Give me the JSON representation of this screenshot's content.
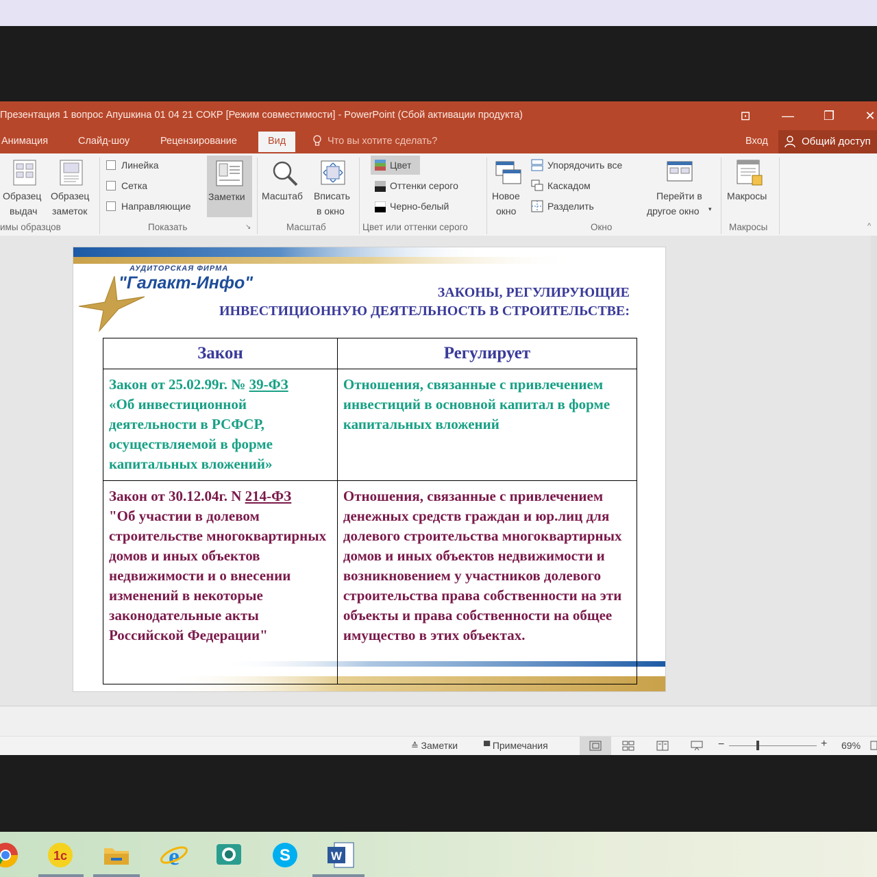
{
  "window": {
    "title": "Презентация 1 вопрос Апушкина  01 04 21 СОКР [Режим совместимости] - PowerPoint (Сбой активации продукта)",
    "buttons": [
      "⊡",
      "—",
      "❐",
      "✕"
    ]
  },
  "tabs": {
    "items": [
      "Анимация",
      "Слайд-шоу",
      "Рецензирование",
      "Вид"
    ],
    "active": "Вид",
    "tell_me": "Что вы хотите сделать?",
    "signin": "Вход",
    "share": "Общий доступ"
  },
  "ribbon": {
    "master_views": {
      "handout_1": "Образец",
      "handout_2": "выдач",
      "notes_1": "Образец",
      "notes_2": "заметок",
      "group_label": "имы образцов"
    },
    "show": {
      "ruler": "Линейка",
      "grid": "Сетка",
      "guides": "Направляющие",
      "notes": "Заметки",
      "group_label": "Показать"
    },
    "zoom": {
      "zoom": "Масштаб",
      "fit_1": "Вписать",
      "fit_2": "в окно",
      "group_label": "Масштаб"
    },
    "color": {
      "color": "Цвет",
      "grayscale": "Оттенки серого",
      "bw": "Черно-белый",
      "group_label": "Цвет или оттенки серого"
    },
    "window": {
      "new_1": "Новое",
      "new_2": "окно",
      "arrange": "Упорядочить все",
      "cascade": "Каскадом",
      "split": "Разделить",
      "switch_1": "Перейти в",
      "switch_2": "другое окно",
      "group_label": "Окно"
    },
    "macros": {
      "macros": "Макросы",
      "group_label": "Макросы"
    }
  },
  "slide": {
    "logo_top": "АУДИТОРСКАЯ  ФИРМА",
    "logo_name": "\"Галакт-Инфо\"",
    "heading_1": "ЗАКОНЫ, РЕГУЛИРУЮЩИЕ",
    "heading_2": "ИНВЕСТИЦИОННУЮ ДЕЯТЕЛЬНОСТЬ В СТРОИТЕЛЬСТВЕ:",
    "table": {
      "headers": [
        "Закон",
        "Регулирует"
      ],
      "row1": {
        "law_prefix": "Закон от 25.02.99г. № ",
        "law_link": "39-ФЗ",
        "law_rest": "«Об инвестиционной деятельности в РСФСР, осуществляемой в форме капитальных вложений»",
        "regulates": "Отношения, связанные с привлечением инвестиций в основной капитал в форме капитальных вложений"
      },
      "row2": {
        "law_prefix": "Закон от 30.12.04г. N ",
        "law_link": "214-ФЗ",
        "law_rest": "\"Об участии в долевом строительстве многоквартирных домов и иных объектов недвижимости и о внесении изменений в некоторые законодательные акты Российской Федерации\"",
        "regulates": "Отношения, связанные с привлечением денежных средств граждан и юр.лиц для долевого строительства многоквартирных домов и иных объектов недвижимости и возникновением у участников долевого строительства права собственности на эти объекты и права собственности на общее имущество в этих объектах."
      }
    },
    "colors": {
      "heading": "#3a3a9a",
      "row1": "#17a085",
      "row2": "#7a1a4a"
    }
  },
  "status": {
    "notes": "Заметки",
    "comments": "Примечания",
    "zoom": "69%"
  }
}
